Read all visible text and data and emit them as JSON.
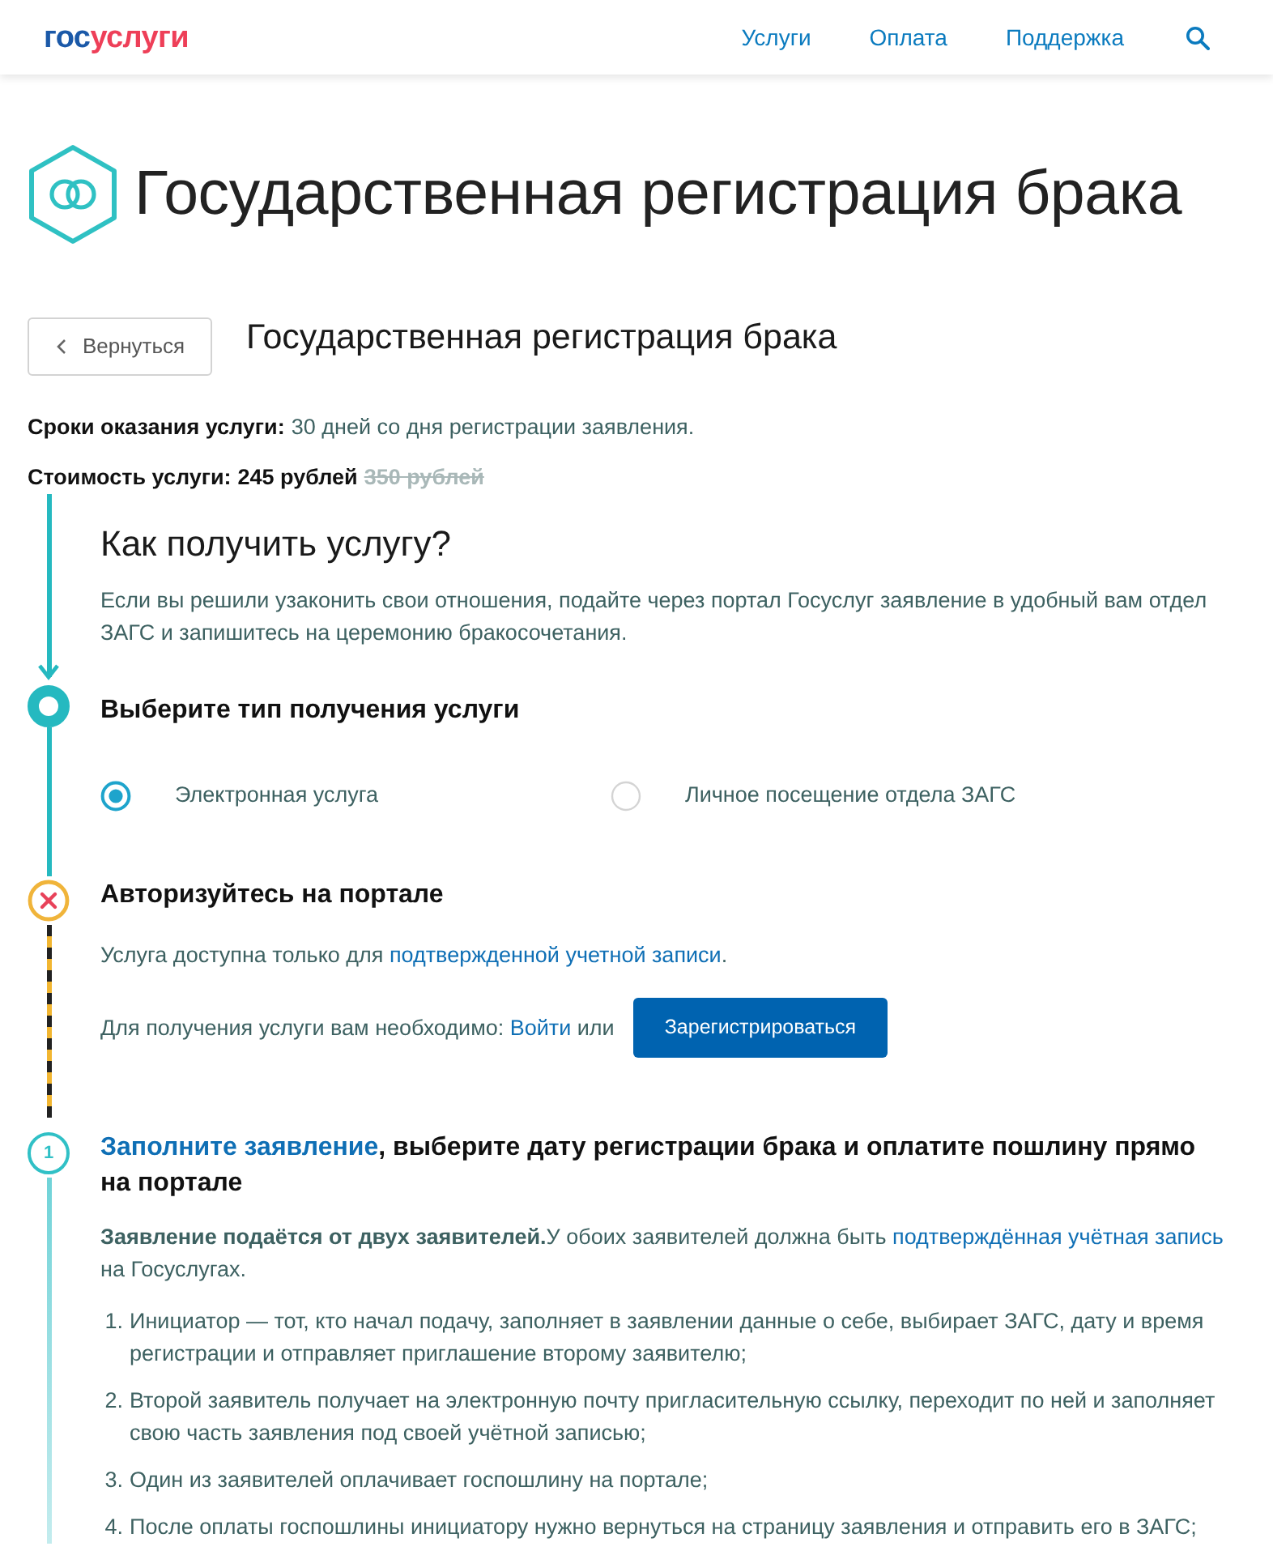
{
  "header": {
    "logo": {
      "part_1": "гос",
      "part_2": "услуги"
    },
    "nav": [
      {
        "label": "Услуги"
      },
      {
        "label": "Оплата"
      },
      {
        "label": "Поддержка"
      }
    ]
  },
  "page_title": "Государственная регистрация брака",
  "back_button": {
    "label": "Вернуться"
  },
  "service_title": "Государственная регистрация брака",
  "facts": [
    {
      "kind": "duration",
      "label": "Сроки оказания услуги:",
      "value": "30 дней со дня регистрации заявления."
    },
    {
      "kind": "price",
      "label": "Стоимость услуги:",
      "value": "245 рублей",
      "old_value": "350 рублей"
    }
  ],
  "steps": [
    {
      "kind": "intro",
      "title": "Как получить услугу?",
      "text": "Если вы решили узаконить свои отношения, подайте через портал Госуслуг заявление в удобный вам отдел ЗАГС и запишитесь на церемонию бракосочетания."
    },
    {
      "kind": "choice",
      "done": true,
      "failed": false,
      "title": "Выберите тип получения услуги",
      "options": [
        {
          "label": "Электронная услуга",
          "selected": true
        },
        {
          "label": "Личное посещение отдела ЗАГС",
          "selected": false
        }
      ]
    },
    {
      "kind": "auth",
      "done": false,
      "failed": true,
      "title": "Авторизуйтесь на портале",
      "note": {
        "before": "Услуга доступна только для ",
        "link": "подтвержденной учетной записи",
        "after": "."
      },
      "action": {
        "before": "Для получения услуги вам необходимо: ",
        "link": "Войти",
        "after": " или"
      },
      "button": "Зарегистрироваться"
    },
    {
      "kind": "form",
      "done": false,
      "failed": false,
      "marker": "1",
      "title": {
        "link": "Заполните заявление",
        "after": ", выберите дату регистрации брака и оплатите пошлину прямо на портале"
      },
      "text": {
        "before": "**Заявление подаётся от двух заявителей.**У обоих заявителей должна быть ",
        "link": "подтверждённая учётная запись",
        "after": " на Госуслугах."
      },
      "items": [
        {
          "number": "1.",
          "text": "Инициатор — тот, кто начал подачу, заполняет в заявлении данные о себе, выбирает ЗАГС, дату и время регистрации и отправляет приглашение второму заявителю;"
        },
        {
          "number": "2.",
          "text": "Второй заявитель получает на электронную почту пригласительную ссылку, переходит по ней и заполняет свою часть заявления под своей учётной записью;"
        },
        {
          "number": "3.",
          "text": "Один из заявителей оплачивает госпошлину на портале;"
        },
        {
          "number": "4.",
          "text": "После оплаты госпошлины инициатору нужно вернуться на страницу заявления и отправить его в ЗАГС;"
        }
      ]
    }
  ]
}
